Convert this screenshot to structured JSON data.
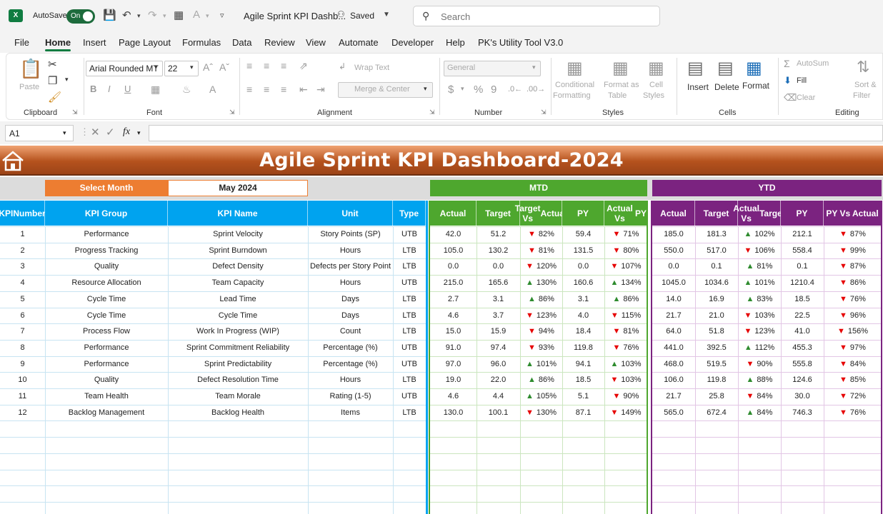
{
  "titlebar": {
    "logo": "X",
    "autosave_label": "AutoSave",
    "toggle_label": "On",
    "doc_title": "Agile Sprint KPI Dashb...",
    "saved_label": "Saved",
    "search_placeholder": "Search"
  },
  "menu": [
    "File",
    "Home",
    "Insert",
    "Page Layout",
    "Formulas",
    "Data",
    "Review",
    "View",
    "Automate",
    "Developer",
    "Help",
    "PK's Utility Tool V3.0"
  ],
  "ribbon": {
    "clipboard": {
      "label": "Clipboard",
      "paste": "Paste"
    },
    "font": {
      "label": "Font",
      "font_name": "Arial Rounded MT",
      "font_size": "22"
    },
    "alignment": {
      "label": "Alignment",
      "wrap_text": "Wrap Text",
      "merge_center": "Merge & Center"
    },
    "number": {
      "label": "Number",
      "format": "General",
      "currency": "$",
      "percent": "%",
      "comma": "9"
    },
    "styles": {
      "label": "Styles",
      "conditional_1": "Conditional",
      "conditional_2": "Formatting",
      "format_table_1": "Format as",
      "format_table_2": "Table",
      "cell_styles_1": "Cell",
      "cell_styles_2": "Styles"
    },
    "cells": {
      "label": "Cells",
      "insert": "Insert",
      "delete": "Delete",
      "format": "Format"
    },
    "editing": {
      "label": "Editing",
      "autosum": "AutoSum",
      "fill": "Fill",
      "clear": "Clear",
      "sort_1": "Sort &",
      "sort_2": "Filter"
    }
  },
  "formula_bar": {
    "name_box": "A1",
    "fx": "fx",
    "value": ""
  },
  "dashboard": {
    "title": "Agile Sprint KPI Dashboard-2024",
    "select_month_label": "Select Month",
    "selected_month": "May 2024",
    "mtd_label": "MTD",
    "ytd_label": "YTD",
    "headers": {
      "kpi_number": [
        "KPI",
        "Number"
      ],
      "kpi_group": "KPI Group",
      "kpi_name": "KPI Name",
      "unit": "Unit",
      "type": "Type",
      "mtd": [
        [
          "Actual"
        ],
        [
          "Target"
        ],
        [
          "Target Vs",
          "Actual"
        ],
        [
          "PY"
        ],
        [
          "Actual Vs",
          "PY"
        ]
      ],
      "ytd": [
        [
          "Actual"
        ],
        [
          "Target"
        ],
        [
          "Actual Vs",
          "Target"
        ],
        [
          "PY"
        ],
        [
          "PY Vs Actual"
        ]
      ]
    },
    "colors": {
      "blue": "#00a3ef",
      "green": "#4ea72e",
      "purple": "#7b2380",
      "orange": "#ed7d31",
      "up": "#2e8b2e",
      "down": "#e60000"
    },
    "rows": [
      {
        "num": "1",
        "group": "Performance",
        "name": "Sprint Velocity",
        "unit": "Story Points (SP)",
        "type": "UTB",
        "mtd_actual": "42.0",
        "mtd_target": "51.2",
        "mtd_tva": "82%",
        "mtd_tva_dir": "down",
        "mtd_py": "59.4",
        "mtd_avp": "71%",
        "mtd_avp_dir": "down",
        "ytd_actual": "185.0",
        "ytd_target": "181.3",
        "ytd_avt": "102%",
        "ytd_avt_dir": "up",
        "ytd_py": "212.1",
        "ytd_pva": "87%",
        "ytd_pva_dir": "down"
      },
      {
        "num": "2",
        "group": "Progress Tracking",
        "name": "Sprint Burndown",
        "unit": "Hours",
        "type": "LTB",
        "mtd_actual": "105.0",
        "mtd_target": "130.2",
        "mtd_tva": "81%",
        "mtd_tva_dir": "down",
        "mtd_py": "131.5",
        "mtd_avp": "80%",
        "mtd_avp_dir": "down",
        "ytd_actual": "550.0",
        "ytd_target": "517.0",
        "ytd_avt": "106%",
        "ytd_avt_dir": "down",
        "ytd_py": "558.4",
        "ytd_pva": "99%",
        "ytd_pva_dir": "down"
      },
      {
        "num": "3",
        "group": "Quality",
        "name": "Defect Density",
        "unit": "Defects per Story Point",
        "type": "LTB",
        "mtd_actual": "0.0",
        "mtd_target": "0.0",
        "mtd_tva": "120%",
        "mtd_tva_dir": "down",
        "mtd_py": "0.0",
        "mtd_avp": "107%",
        "mtd_avp_dir": "down",
        "ytd_actual": "0.0",
        "ytd_target": "0.1",
        "ytd_avt": "81%",
        "ytd_avt_dir": "up",
        "ytd_py": "0.1",
        "ytd_pva": "87%",
        "ytd_pva_dir": "down"
      },
      {
        "num": "4",
        "group": "Resource Allocation",
        "name": "Team Capacity",
        "unit": "Hours",
        "type": "UTB",
        "mtd_actual": "215.0",
        "mtd_target": "165.6",
        "mtd_tva": "130%",
        "mtd_tva_dir": "up",
        "mtd_py": "160.6",
        "mtd_avp": "134%",
        "mtd_avp_dir": "up",
        "ytd_actual": "1045.0",
        "ytd_target": "1034.6",
        "ytd_avt": "101%",
        "ytd_avt_dir": "up",
        "ytd_py": "1210.4",
        "ytd_pva": "86%",
        "ytd_pva_dir": "down"
      },
      {
        "num": "5",
        "group": "Cycle Time",
        "name": "Lead Time",
        "unit": "Days",
        "type": "LTB",
        "mtd_actual": "2.7",
        "mtd_target": "3.1",
        "mtd_tva": "86%",
        "mtd_tva_dir": "up",
        "mtd_py": "3.1",
        "mtd_avp": "86%",
        "mtd_avp_dir": "up",
        "ytd_actual": "14.0",
        "ytd_target": "16.9",
        "ytd_avt": "83%",
        "ytd_avt_dir": "up",
        "ytd_py": "18.5",
        "ytd_pva": "76%",
        "ytd_pva_dir": "down"
      },
      {
        "num": "6",
        "group": "Cycle Time",
        "name": "Cycle Time",
        "unit": "Days",
        "type": "LTB",
        "mtd_actual": "4.6",
        "mtd_target": "3.7",
        "mtd_tva": "123%",
        "mtd_tva_dir": "down",
        "mtd_py": "4.0",
        "mtd_avp": "115%",
        "mtd_avp_dir": "down",
        "ytd_actual": "21.7",
        "ytd_target": "21.0",
        "ytd_avt": "103%",
        "ytd_avt_dir": "down",
        "ytd_py": "22.5",
        "ytd_pva": "96%",
        "ytd_pva_dir": "down"
      },
      {
        "num": "7",
        "group": "Process Flow",
        "name": "Work In Progress (WIP)",
        "unit": "Count",
        "type": "LTB",
        "mtd_actual": "15.0",
        "mtd_target": "15.9",
        "mtd_tva": "94%",
        "mtd_tva_dir": "down",
        "mtd_py": "18.4",
        "mtd_avp": "81%",
        "mtd_avp_dir": "down",
        "ytd_actual": "64.0",
        "ytd_target": "51.8",
        "ytd_avt": "123%",
        "ytd_avt_dir": "down",
        "ytd_py": "41.0",
        "ytd_pva": "156%",
        "ytd_pva_dir": "down"
      },
      {
        "num": "8",
        "group": "Performance",
        "name": "Sprint Commitment Reliability",
        "unit": "Percentage (%)",
        "type": "UTB",
        "mtd_actual": "91.0",
        "mtd_target": "97.4",
        "mtd_tva": "93%",
        "mtd_tva_dir": "down",
        "mtd_py": "119.8",
        "mtd_avp": "76%",
        "mtd_avp_dir": "down",
        "ytd_actual": "441.0",
        "ytd_target": "392.5",
        "ytd_avt": "112%",
        "ytd_avt_dir": "up",
        "ytd_py": "455.3",
        "ytd_pva": "97%",
        "ytd_pva_dir": "down"
      },
      {
        "num": "9",
        "group": "Performance",
        "name": "Sprint Predictability",
        "unit": "Percentage (%)",
        "type": "UTB",
        "mtd_actual": "97.0",
        "mtd_target": "96.0",
        "mtd_tva": "101%",
        "mtd_tva_dir": "up",
        "mtd_py": "94.1",
        "mtd_avp": "103%",
        "mtd_avp_dir": "up",
        "ytd_actual": "468.0",
        "ytd_target": "519.5",
        "ytd_avt": "90%",
        "ytd_avt_dir": "down",
        "ytd_py": "555.8",
        "ytd_pva": "84%",
        "ytd_pva_dir": "down"
      },
      {
        "num": "10",
        "group": "Quality",
        "name": "Defect Resolution Time",
        "unit": "Hours",
        "type": "LTB",
        "mtd_actual": "19.0",
        "mtd_target": "22.0",
        "mtd_tva": "86%",
        "mtd_tva_dir": "up",
        "mtd_py": "18.5",
        "mtd_avp": "103%",
        "mtd_avp_dir": "down",
        "ytd_actual": "106.0",
        "ytd_target": "119.8",
        "ytd_avt": "88%",
        "ytd_avt_dir": "up",
        "ytd_py": "124.6",
        "ytd_pva": "85%",
        "ytd_pva_dir": "down"
      },
      {
        "num": "11",
        "group": "Team Health",
        "name": "Team Morale",
        "unit": "Rating (1-5)",
        "type": "UTB",
        "mtd_actual": "4.6",
        "mtd_target": "4.4",
        "mtd_tva": "105%",
        "mtd_tva_dir": "up",
        "mtd_py": "5.1",
        "mtd_avp": "90%",
        "mtd_avp_dir": "down",
        "ytd_actual": "21.7",
        "ytd_target": "25.8",
        "ytd_avt": "84%",
        "ytd_avt_dir": "down",
        "ytd_py": "30.0",
        "ytd_pva": "72%",
        "ytd_pva_dir": "down"
      },
      {
        "num": "12",
        "group": "Backlog Management",
        "name": "Backlog Health",
        "unit": "Items",
        "type": "LTB",
        "mtd_actual": "130.0",
        "mtd_target": "100.1",
        "mtd_tva": "130%",
        "mtd_tva_dir": "down",
        "mtd_py": "87.1",
        "mtd_avp": "149%",
        "mtd_avp_dir": "down",
        "ytd_actual": "565.0",
        "ytd_target": "672.4",
        "ytd_avt": "84%",
        "ytd_avt_dir": "up",
        "ytd_py": "746.3",
        "ytd_pva": "76%",
        "ytd_pva_dir": "down"
      }
    ]
  }
}
